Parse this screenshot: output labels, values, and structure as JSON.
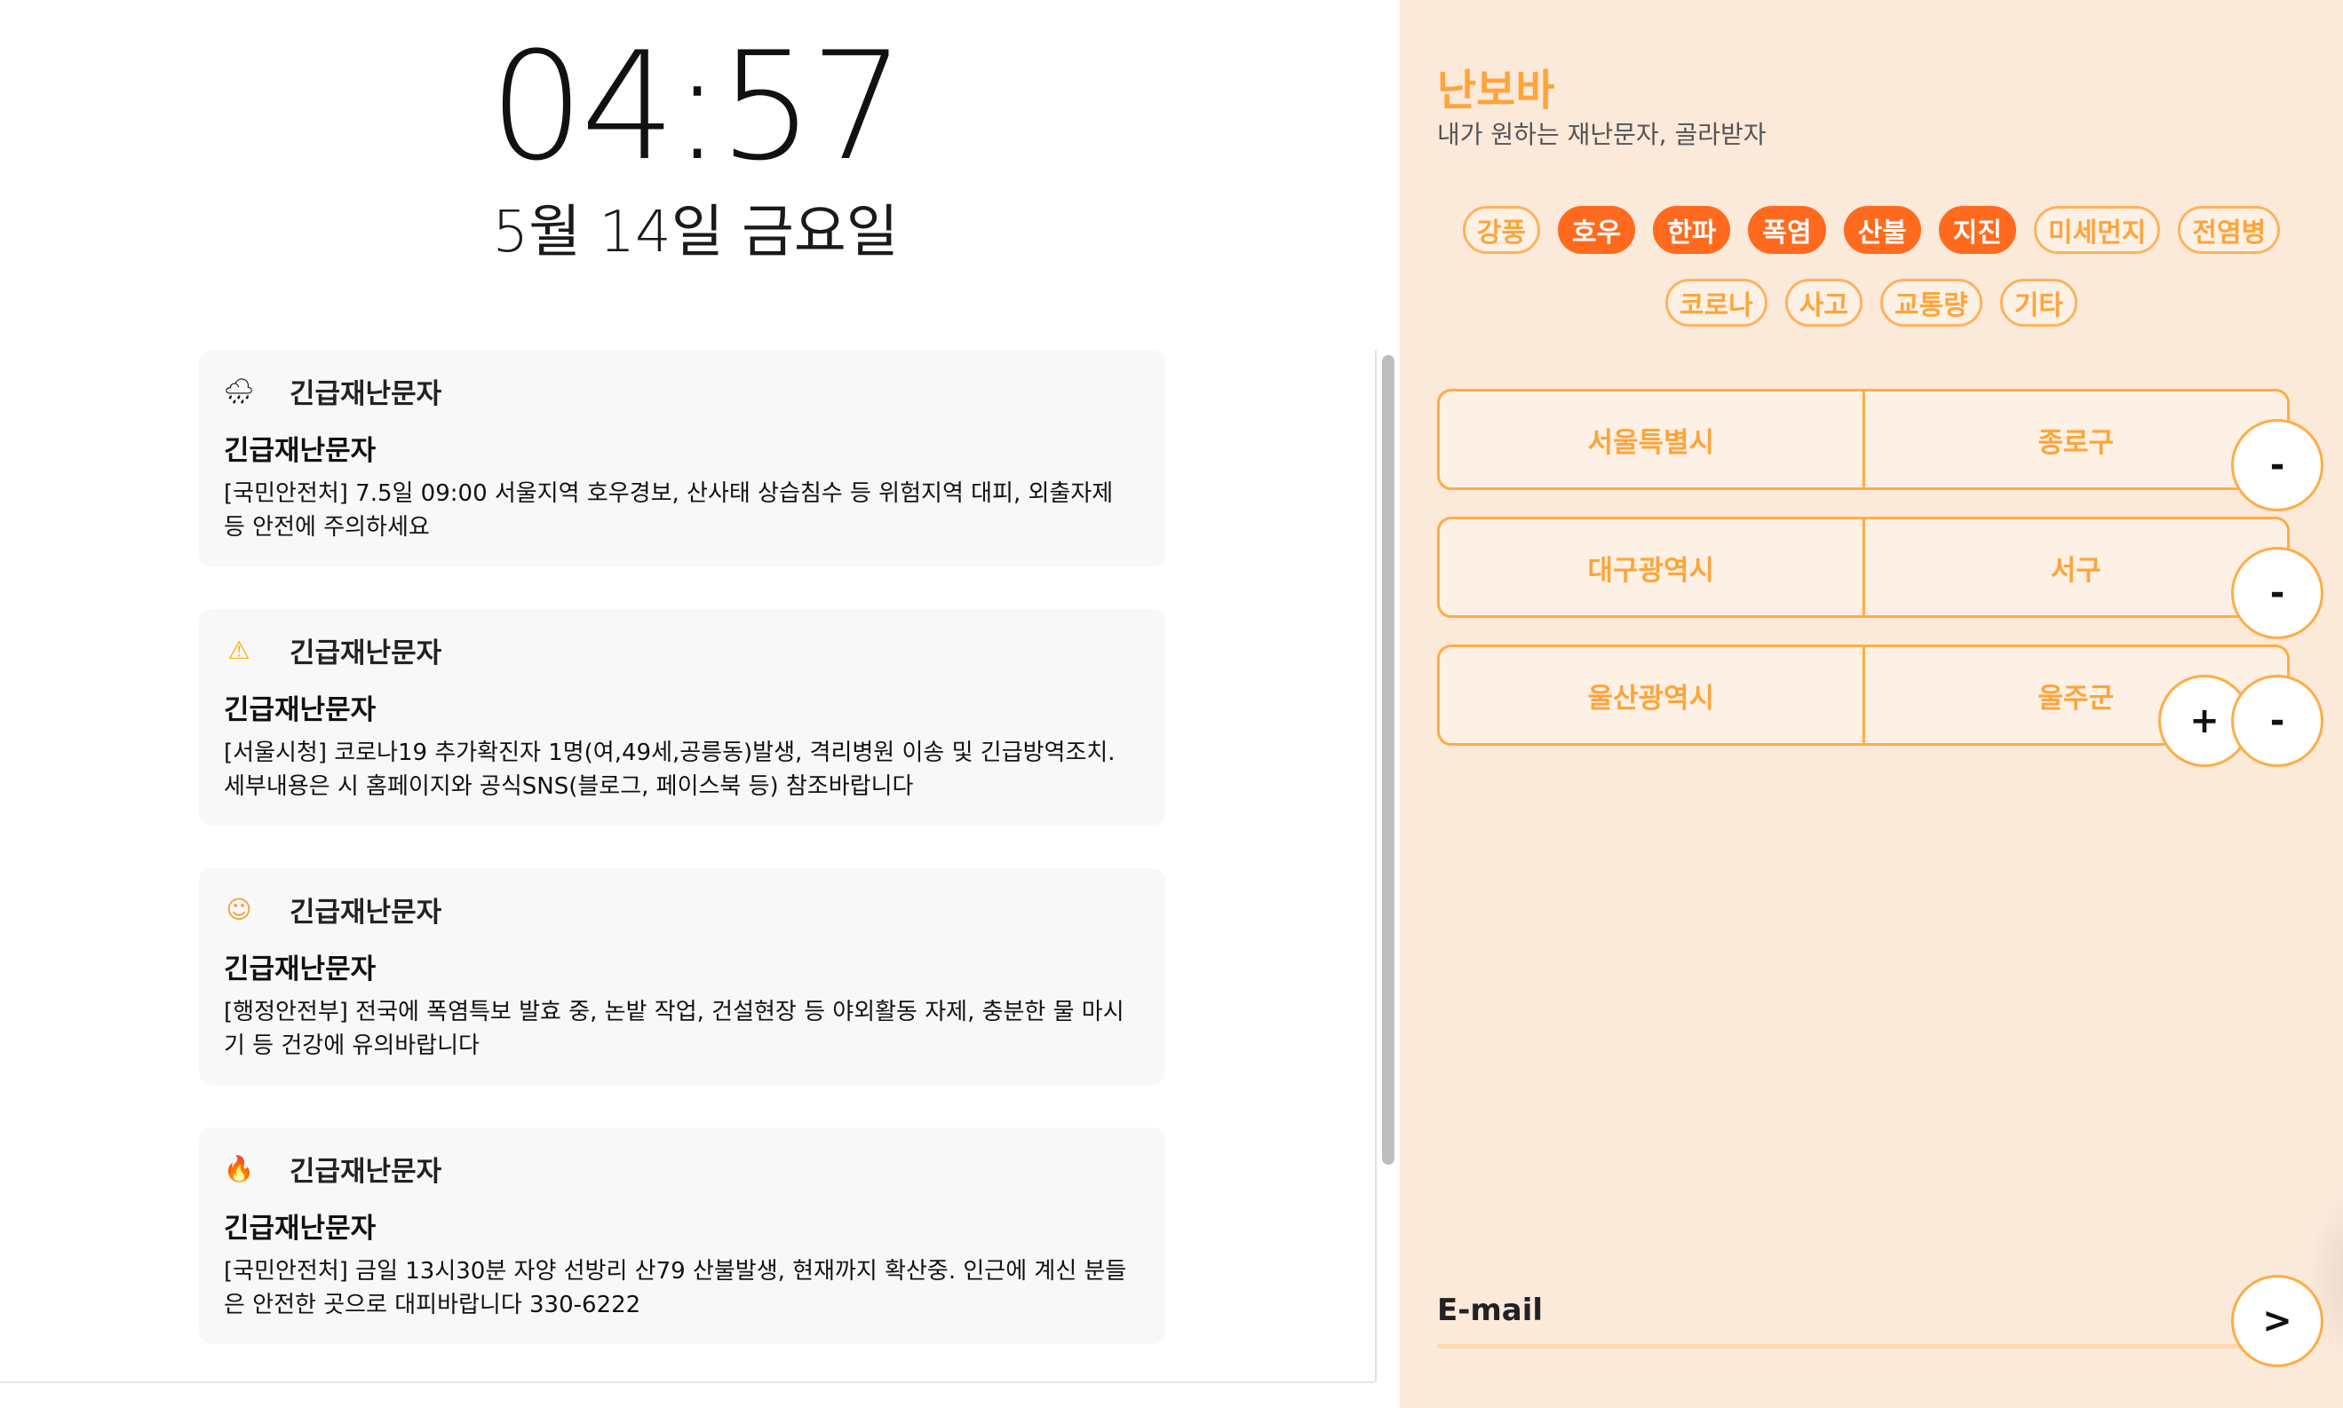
{
  "lock_screen": {
    "time": "04:57",
    "date": "5월 14일 금요일"
  },
  "notifications": [
    {
      "icon": "rain-cloud-icon",
      "icon_glyph": "🌧",
      "app": "긴급재난문자",
      "title": "긴급재난문자",
      "body": "[국민안전처] 7.5일 09:00 서울지역 호우경보, 산사태 상습침수 등 위험지역 대피, 외출자제 등 안전에 주의하세요"
    },
    {
      "icon": "warning-icon",
      "icon_glyph": "⚠",
      "app": "긴급재난문자",
      "title": "긴급재난문자",
      "body": "[서울시청] 코로나19 추가확진자 1명(여,49세,공릉동)발생, 격리병원 이송 및 긴급방역조치. 세부내용은 시 홈페이지와 공식SNS(블로그, 페이스북 등) 참조바랍니다"
    },
    {
      "icon": "hot-face-icon",
      "icon_glyph": "☺",
      "app": "긴급재난문자",
      "title": "긴급재난문자",
      "body": "[행정안전부] 전국에 폭염특보 발효 중, 논밭 작업, 건설현장 등 야외활동 자제, 충분한 물 마시기 등 건강에 유의바랍니다"
    },
    {
      "icon": "fire-icon",
      "icon_glyph": "🔥",
      "app": "긴급재난문자",
      "title": "긴급재난문자",
      "body": "[국민안전처] 금일 13시30분 자양 선방리 산79 산불발생, 현재까지 확산중. 인근에 계신 분들은 안전한 곳으로 대피바랍니다 330-6222"
    }
  ],
  "panel": {
    "title": "난보바",
    "subtitle": "내가 원하는 재난문자, 골라받자",
    "categories_row1": [
      {
        "label": "강풍",
        "selected": false
      },
      {
        "label": "호우",
        "selected": true
      },
      {
        "label": "한파",
        "selected": true
      },
      {
        "label": "폭염",
        "selected": true
      },
      {
        "label": "산불",
        "selected": true
      },
      {
        "label": "지진",
        "selected": true
      },
      {
        "label": "미세먼지",
        "selected": false
      },
      {
        "label": "전염병",
        "selected": false
      }
    ],
    "categories_row2": [
      {
        "label": "코로나",
        "selected": false
      },
      {
        "label": "사고",
        "selected": false
      },
      {
        "label": "교통량",
        "selected": false
      },
      {
        "label": "기타",
        "selected": false
      }
    ],
    "regions": [
      {
        "city": "서울특별시",
        "district": "종로구"
      },
      {
        "city": "대구광역시",
        "district": "서구"
      },
      {
        "city": "울산광역시",
        "district": "울주군"
      }
    ],
    "remove_label": "-",
    "add_label": "+",
    "email_label": "E-mail",
    "submit_label": ">",
    "colors": {
      "accent": "#ffa43a",
      "selected": "#ff6a1f",
      "background": "#fbe9da"
    }
  }
}
